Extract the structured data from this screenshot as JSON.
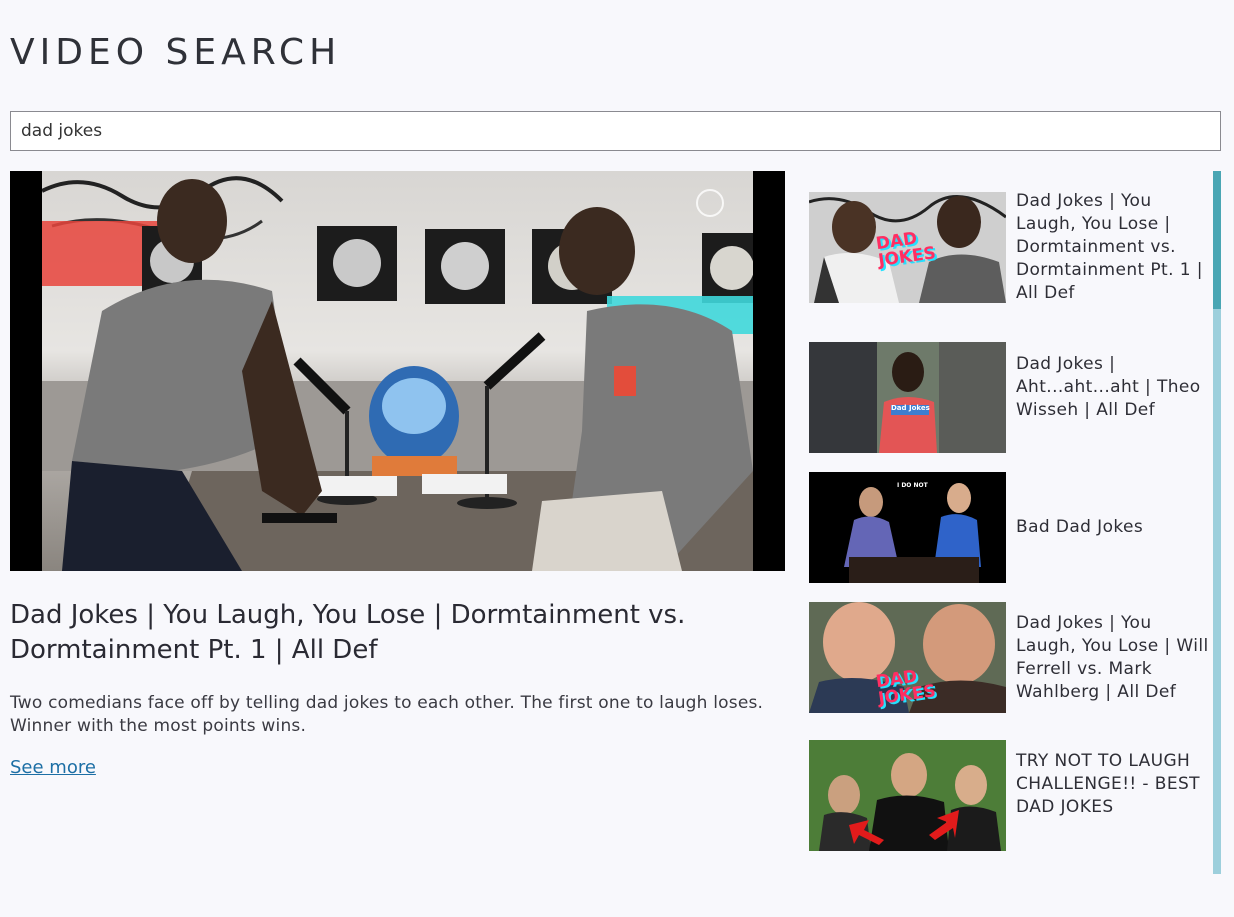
{
  "header": {
    "title": "VIDEO SEARCH"
  },
  "search": {
    "value": "dad jokes",
    "placeholder": ""
  },
  "player": {
    "title": "Dad Jokes | You Laugh, You Lose | Dormtainment vs. Dormtainment Pt. 1 | All Def",
    "description": "Two comedians face off by telling dad jokes to each other. The first one to laugh loses. Winner with the most points wins.",
    "see_more_label": "See more"
  },
  "results": [
    {
      "title": "Dad Jokes | You Laugh, You Lose | Dormtainment vs. Dormtainment Pt. 1 | All Def",
      "thumb_text": "DAD JOKES"
    },
    {
      "title": "Dad Jokes | Aht...aht...aht | Theo Wisseh | All Def",
      "thumb_text": "Dad Jokes"
    },
    {
      "title": "Bad Dad Jokes",
      "thumb_text": "I DO NOT"
    },
    {
      "title": "Dad Jokes | You Laugh, You Lose | Will Ferrell vs. Mark Wahlberg | All Def",
      "thumb_text": "DAD JOKES"
    },
    {
      "title": "TRY NOT TO LAUGH CHALLENGE!! - BEST DAD JOKES",
      "thumb_text": ""
    }
  ],
  "colors": {
    "background": "#f8f8fc",
    "link": "#1d6fa5",
    "scrollbar_track": "#9dcfdc",
    "scrollbar_thumb": "#4aa6b4"
  }
}
